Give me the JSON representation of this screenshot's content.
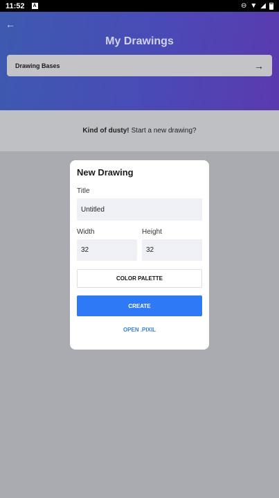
{
  "status_bar": {
    "time": "11:52",
    "notification": "A"
  },
  "header": {
    "title": "My Drawings",
    "bases_label": "Drawing Bases"
  },
  "empty_state": {
    "bold": "Kind of dusty!",
    "rest": "Start a new drawing?"
  },
  "modal": {
    "title": "New Drawing",
    "title_label": "Title",
    "title_value": "Untitled",
    "width_label": "Width",
    "width_value": "32",
    "height_label": "Height",
    "height_value": "32",
    "palette_button": "COLOR PALETTE",
    "create_button": "CREATE",
    "open_link": "OPEN .PIXIL"
  },
  "colors": {
    "primary": "#2e79f6",
    "link": "#3d7fd6"
  }
}
